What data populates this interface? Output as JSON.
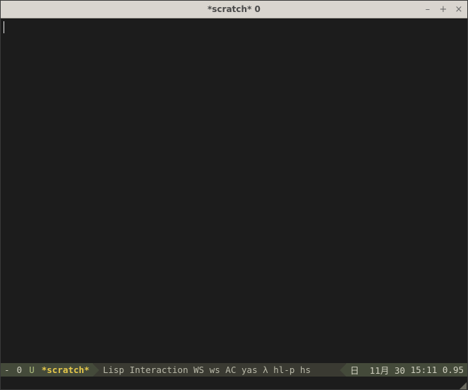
{
  "titlebar": {
    "title": "*scratch*  0",
    "minimize_glyph": "–",
    "maximize_glyph": "+",
    "close_glyph": "×"
  },
  "editor": {
    "content": ""
  },
  "modeline": {
    "modified": "-",
    "position": "0",
    "encoding": "U",
    "buffer": "*scratch*",
    "major_mode": "Lisp Interaction",
    "minor_modes": "WS ws AC yas λ hl-p hs",
    "day": "日",
    "date": "11月 30",
    "time": "15:11",
    "load": "0.95"
  }
}
